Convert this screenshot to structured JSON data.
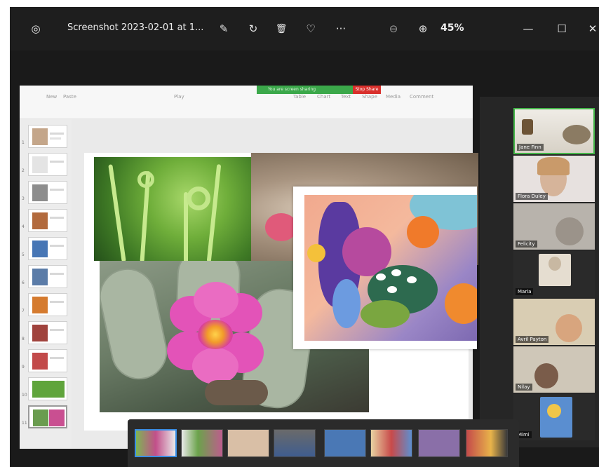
{
  "window": {
    "title": "Screenshot 2023-02-01 at 1...",
    "zoom": "45%",
    "toolbar_icons": [
      "app-icon",
      "edit-image-icon",
      "rotate-icon",
      "delete-icon",
      "favorite-icon",
      "more-icon",
      "zoom-out-icon",
      "zoom-in-icon"
    ],
    "window_controls": [
      "minimize-icon",
      "maximize-icon",
      "close-icon"
    ],
    "glyphs": {
      "app": "◎",
      "edit": "✎",
      "rotate": "↻",
      "delete": "🗑",
      "favorite": "♡",
      "more": "···",
      "zoom_out": "⊖",
      "zoom_in": "⊕",
      "minimize": "—",
      "maximize": "☐",
      "close": "✕"
    }
  },
  "ppt": {
    "share_text": "You are screen sharing",
    "stop_share": "Stop Share",
    "ribbon": [
      "New",
      "Paste",
      "Play",
      "Table",
      "Chart",
      "Text",
      "Shape",
      "Media",
      "Comment"
    ],
    "slide_numbers": [
      "1",
      "2",
      "3",
      "4",
      "5",
      "6",
      "7",
      "8",
      "9",
      "10",
      "11"
    ]
  },
  "participants": [
    {
      "name": "Jane Finn",
      "active": true,
      "bg": "#c9b79a"
    },
    {
      "name": "Flora Duley",
      "active": false,
      "bg": "#e7e1df"
    },
    {
      "name": "Felicity",
      "active": false,
      "bg": "#b8b3ac"
    },
    {
      "name": "Maria",
      "active": false,
      "bg": "#2a2a2a"
    },
    {
      "name": "Avril Payton",
      "active": false,
      "bg": "#d9cdb3"
    },
    {
      "name": "Nilay",
      "active": false,
      "bg": "#cfc7b8"
    },
    {
      "name": "Mimi",
      "active": false,
      "bg": "#2a2a2a"
    }
  ],
  "filmstrip": {
    "selected": 0,
    "count": 9
  },
  "colors": {
    "share_green": "#3ba84a",
    "stop_red": "#d9302c",
    "active_speaker": "#44b548",
    "filmstrip_select": "#3a8ee6"
  }
}
